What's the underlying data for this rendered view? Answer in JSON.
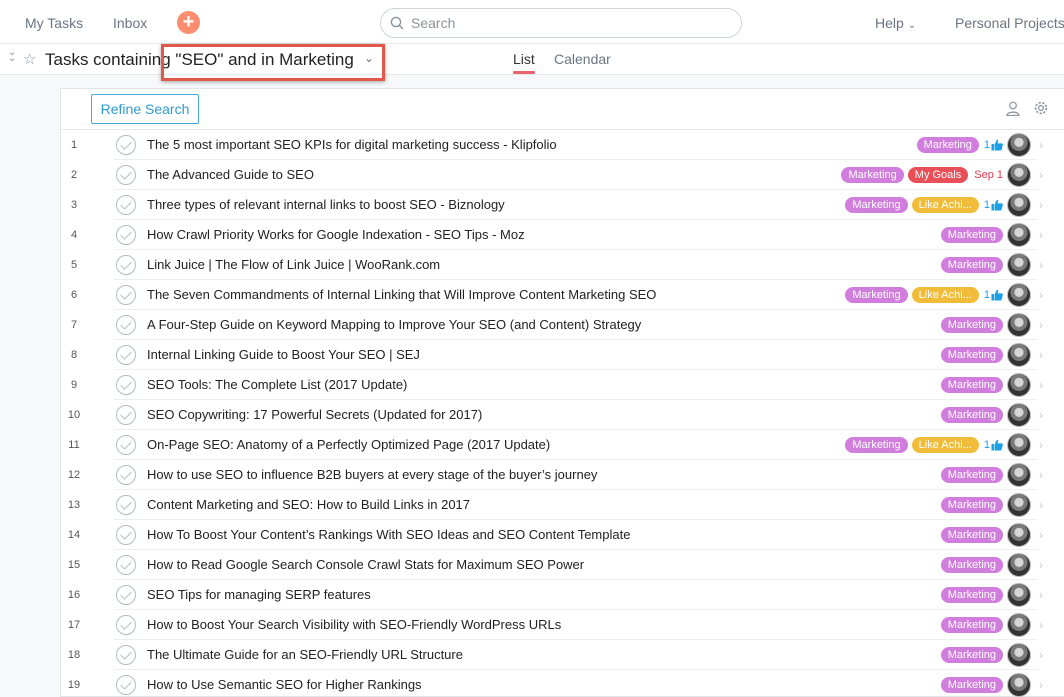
{
  "topbar": {
    "my_tasks": "My Tasks",
    "inbox": "Inbox",
    "add_symbol": "+",
    "search_placeholder": "Search",
    "help": "Help",
    "projects": "Personal Projects"
  },
  "header": {
    "title": "Tasks containing \"SEO\" and in Marketing",
    "tabs": [
      {
        "label": "List",
        "active": true
      },
      {
        "label": "Calendar",
        "active": false
      }
    ]
  },
  "toolbar": {
    "refine_label": "Refine Search"
  },
  "colors": {
    "marketing": "#d17ddd",
    "my_goals": "#e94f57",
    "like_achi": "#f0bc3a",
    "accent": "#fc8d6e"
  },
  "tasks": [
    {
      "num": "1",
      "name": "The 5 most important SEO KPIs for digital marketing success - Klipfolio",
      "tags": [
        {
          "label": "Marketing",
          "color": "#d17ddd"
        }
      ],
      "likes": "1"
    },
    {
      "num": "2",
      "name": "The Advanced Guide to SEO",
      "tags": [
        {
          "label": "Marketing",
          "color": "#d17ddd"
        },
        {
          "label": "My Goals",
          "color": "#e94f57"
        }
      ],
      "due": "Sep 1"
    },
    {
      "num": "3",
      "name": "Three types of relevant internal links to boost SEO - Biznology",
      "tags": [
        {
          "label": "Marketing",
          "color": "#d17ddd"
        },
        {
          "label": "Like Achi...",
          "color": "#f0bc3a"
        }
      ],
      "likes": "1"
    },
    {
      "num": "4",
      "name": "How Crawl Priority Works for Google Indexation - SEO Tips - Moz",
      "tags": [
        {
          "label": "Marketing",
          "color": "#d17ddd"
        }
      ]
    },
    {
      "num": "5",
      "name": "Link Juice | The Flow of Link Juice | WooRank.com",
      "tags": [
        {
          "label": "Marketing",
          "color": "#d17ddd"
        }
      ]
    },
    {
      "num": "6",
      "name": "The Seven Commandments of Internal Linking that Will Improve Content Marketing SEO",
      "tags": [
        {
          "label": "Marketing",
          "color": "#d17ddd"
        },
        {
          "label": "Like Achi...",
          "color": "#f0bc3a"
        }
      ],
      "likes": "1"
    },
    {
      "num": "7",
      "name": "A Four-Step Guide on Keyword Mapping to Improve Your SEO (and Content) Strategy",
      "tags": [
        {
          "label": "Marketing",
          "color": "#d17ddd"
        }
      ]
    },
    {
      "num": "8",
      "name": "Internal Linking Guide to Boost Your SEO | SEJ",
      "tags": [
        {
          "label": "Marketing",
          "color": "#d17ddd"
        }
      ]
    },
    {
      "num": "9",
      "name": "SEO Tools: The Complete List (2017 Update)",
      "tags": [
        {
          "label": "Marketing",
          "color": "#d17ddd"
        }
      ]
    },
    {
      "num": "10",
      "name": "SEO Copywriting: 17 Powerful Secrets (Updated for 2017)",
      "tags": [
        {
          "label": "Marketing",
          "color": "#d17ddd"
        }
      ]
    },
    {
      "num": "11",
      "name": "On-Page SEO: Anatomy of a Perfectly Optimized Page (2017 Update)",
      "tags": [
        {
          "label": "Marketing",
          "color": "#d17ddd"
        },
        {
          "label": "Like Achi...",
          "color": "#f0bc3a"
        }
      ],
      "likes": "1"
    },
    {
      "num": "12",
      "name": "How to use SEO to influence B2B buyers at every stage of the buyer’s journey",
      "tags": [
        {
          "label": "Marketing",
          "color": "#d17ddd"
        }
      ]
    },
    {
      "num": "13",
      "name": "Content Marketing and SEO: How to Build Links in 2017",
      "tags": [
        {
          "label": "Marketing",
          "color": "#d17ddd"
        }
      ]
    },
    {
      "num": "14",
      "name": "How To Boost Your Content’s Rankings With SEO Ideas and SEO Content Template",
      "tags": [
        {
          "label": "Marketing",
          "color": "#d17ddd"
        }
      ]
    },
    {
      "num": "15",
      "name": "How to Read Google Search Console Crawl Stats for Maximum SEO Power",
      "tags": [
        {
          "label": "Marketing",
          "color": "#d17ddd"
        }
      ]
    },
    {
      "num": "16",
      "name": "SEO Tips for managing SERP features",
      "tags": [
        {
          "label": "Marketing",
          "color": "#d17ddd"
        }
      ]
    },
    {
      "num": "17",
      "name": "How to Boost Your Search Visibility with SEO-Friendly WordPress URLs",
      "tags": [
        {
          "label": "Marketing",
          "color": "#d17ddd"
        }
      ]
    },
    {
      "num": "18",
      "name": "The Ultimate Guide for an SEO-Friendly URL Structure",
      "tags": [
        {
          "label": "Marketing",
          "color": "#d17ddd"
        }
      ]
    },
    {
      "num": "19",
      "name": "How to Use Semantic SEO for Higher Rankings",
      "tags": [
        {
          "label": "Marketing",
          "color": "#d17ddd"
        }
      ]
    }
  ]
}
